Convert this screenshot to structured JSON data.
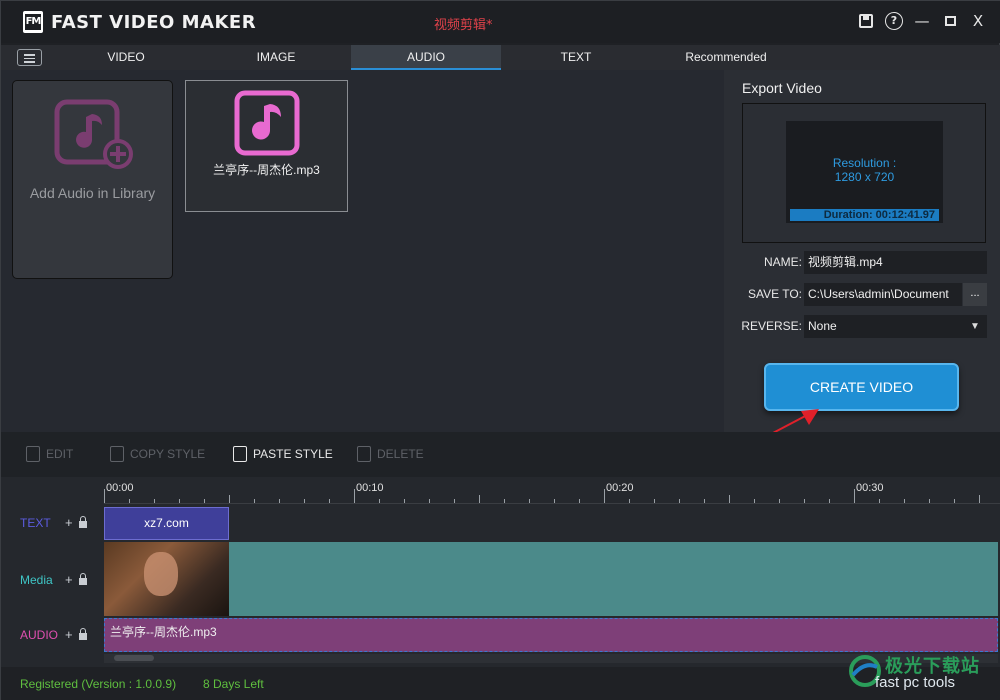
{
  "window": {
    "app_name": "FAST VIDEO MAKER",
    "doc_title": "视频剪辑*",
    "logo_text": "FM"
  },
  "tabs": [
    {
      "label": "VIDEO",
      "active": false
    },
    {
      "label": "IMAGE",
      "active": false
    },
    {
      "label": "AUDIO",
      "active": true
    },
    {
      "label": "TEXT",
      "active": false
    },
    {
      "label": "Recommended",
      "active": false
    }
  ],
  "library": {
    "add_label": "Add Audio in Library",
    "items": [
      {
        "name": "兰亭序--周杰伦.mp3",
        "icon": "music-note-icon"
      }
    ]
  },
  "export": {
    "title": "Export Video",
    "resolution_label": "Resolution :",
    "resolution_value": "1280 x 720",
    "duration": "Duration: 00:12:41.97",
    "name_label": "NAME:",
    "name_value": "视频剪辑.mp4",
    "save_label": "SAVE TO:",
    "save_value": "C:\\Users\\admin\\Document",
    "save_browse": "...",
    "reverse_label": "REVERSE:",
    "reverse_value": "None",
    "create_button": "CREATE VIDEO"
  },
  "toolbar": {
    "edit": "EDIT",
    "copy_style": "COPY STYLE",
    "paste_style": "PASTE STYLE",
    "delete": "DELETE"
  },
  "timeline": {
    "time_marks": [
      "00:00",
      "00:10",
      "00:20",
      "00:30"
    ],
    "tracks": {
      "text": {
        "label": "TEXT",
        "color": "#5c5ce0",
        "clip": "xz7.com"
      },
      "media": {
        "label": "Media",
        "color": "#3fc6c6"
      },
      "audio": {
        "label": "AUDIO",
        "color": "#e04fb0",
        "clip": "兰亭序--周杰伦.mp3"
      }
    }
  },
  "status": {
    "registered": "Registered (Version : 1.0.0.9)",
    "days_left": "8 Days Left"
  },
  "watermark": {
    "line1": "极光下载站",
    "line2": "fast pc tools"
  },
  "colors": {
    "accent": "#1f8fd4",
    "title_red": "#e0424a",
    "status_green": "#5fbf3f",
    "music_pink": "#e86ad0"
  }
}
